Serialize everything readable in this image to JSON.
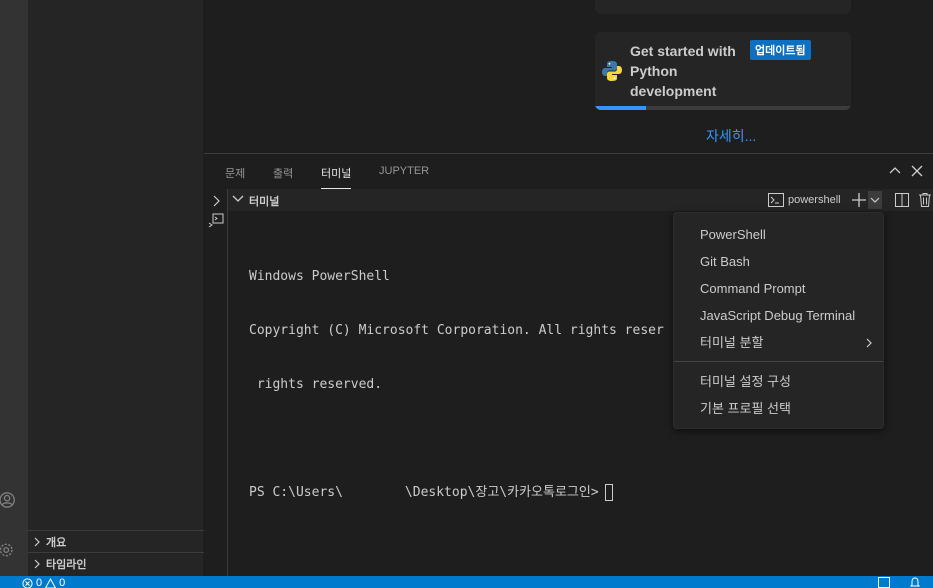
{
  "sidebar": {
    "sections": [
      {
        "label": "개요"
      },
      {
        "label": "타임라인"
      }
    ]
  },
  "walkthrough": {
    "title": "Get started with Python development",
    "badge": "업데이트됨",
    "progress_percent": 20,
    "more_link": "자세히..."
  },
  "panel": {
    "tabs": [
      {
        "label": "문제",
        "active": false
      },
      {
        "label": "출력",
        "active": false
      },
      {
        "label": "터미널",
        "active": true
      },
      {
        "label": "JUPYTER",
        "active": false
      }
    ],
    "terminal_header": "터미널",
    "profile": "powershell"
  },
  "terminal": {
    "lines": [
      "Windows PowerShell",
      "Copyright (C) Microsoft Corporation. All rights reser",
      " rights reserved."
    ],
    "prompt_before": "PS C:\\Users\\",
    "prompt_after": "\\Desktop\\장고\\카카오톡로그인>"
  },
  "dropdown": {
    "profiles": [
      "PowerShell",
      "Git Bash",
      "Command Prompt",
      "JavaScript Debug Terminal"
    ],
    "split_label": "터미널 분할",
    "settings": [
      "터미널 설정 구성",
      "기본 프로필 선택"
    ]
  },
  "status_bar": {
    "errors": "0",
    "warnings": "0"
  },
  "colors": {
    "accent": "#007acc",
    "link": "#3794ff",
    "badge": "#0e70c0"
  }
}
